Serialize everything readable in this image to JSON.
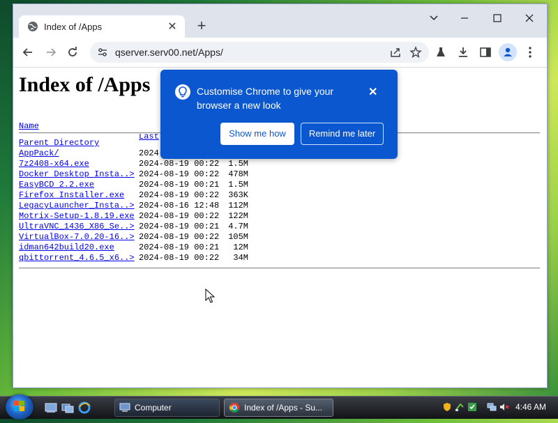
{
  "browser": {
    "tab_title": "Index of /Apps",
    "url": "qserver.serv00.net/Apps/"
  },
  "page": {
    "heading": "Index of /Apps",
    "headers": {
      "name": "Name",
      "last_modified_partial": "Last"
    },
    "rows": [
      {
        "name": "Parent Directory",
        "date": "",
        "size": ""
      },
      {
        "name": "AppPack/",
        "date": "2024-",
        "size": ""
      },
      {
        "name": "7z2408-x64.exe",
        "date": "2024-08-19 00:22",
        "size": "1.5M"
      },
      {
        "name": "Docker Desktop Insta..>",
        "date": "2024-08-19 00:22",
        "size": "478M"
      },
      {
        "name": "EasyBCD 2.2.exe",
        "date": "2024-08-19 00:21",
        "size": "1.5M"
      },
      {
        "name": "Firefox Installer.exe",
        "date": "2024-08-19 00:22",
        "size": "363K"
      },
      {
        "name": "LegacyLauncher_Insta..>",
        "date": "2024-08-16 12:48",
        "size": "112M"
      },
      {
        "name": "Motrix-Setup-1.8.19.exe",
        "date": "2024-08-19 00:22",
        "size": "122M"
      },
      {
        "name": "UltraVNC_1436_X86_Se..>",
        "date": "2024-08-19 00:21",
        "size": "4.7M"
      },
      {
        "name": "VirtualBox-7.0.20-16..>",
        "date": "2024-08-19 00:22",
        "size": "105M"
      },
      {
        "name": "idman642build20.exe",
        "date": "2024-08-19 00:21",
        "size": "12M"
      },
      {
        "name": "qbittorrent_4.6.5_x6..>",
        "date": "2024-08-19 00:22",
        "size": "34M"
      }
    ]
  },
  "popup": {
    "message": "Customise Chrome to give your browser a new look",
    "primary_label": "Show me how",
    "secondary_label": "Remind me later"
  },
  "taskbar": {
    "items": [
      {
        "label": "Computer"
      },
      {
        "label": "Index of /Apps - Su..."
      }
    ],
    "clock": "4:46 AM"
  },
  "colors": {
    "popup_bg": "#0b57d0",
    "link": "#0000ee"
  }
}
